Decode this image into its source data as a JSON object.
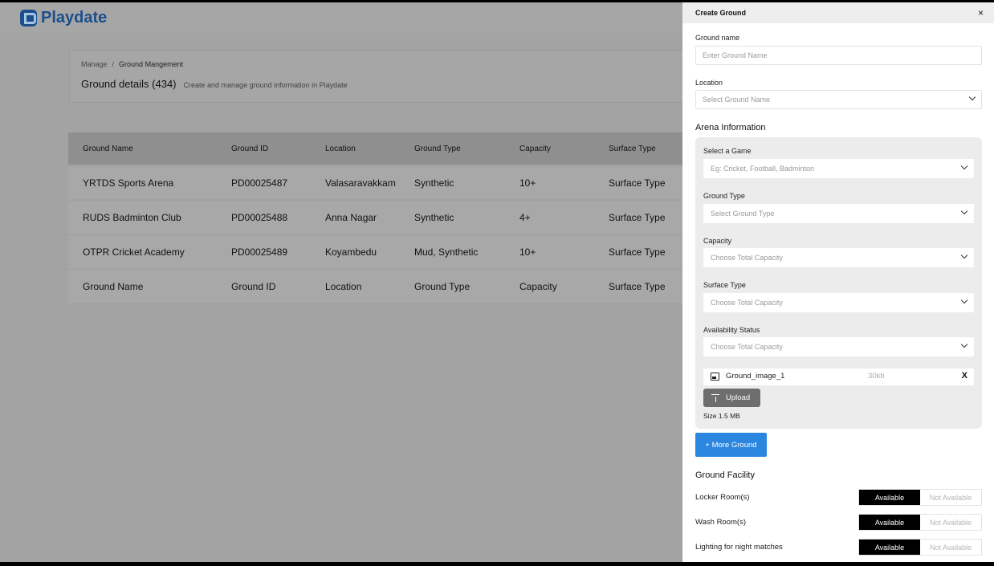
{
  "app": {
    "name": "Playdate"
  },
  "breadcrumb": {
    "root": "Manage",
    "separator": "/",
    "current": "Ground Mangement"
  },
  "page": {
    "title": "Ground details (434)",
    "subtitle": "Create and manage ground information in Playdate"
  },
  "table": {
    "columns": [
      "Ground Name",
      "Ground ID",
      "Location",
      "Ground Type",
      "Capacity",
      "Surface Type"
    ],
    "rows": [
      [
        "YRTDS Sports Arena",
        "PD00025487",
        "Valasaravakkam",
        "Synthetic",
        "10+",
        "Surface Type"
      ],
      [
        "RUDS Badminton Club",
        "PD00025488",
        "Anna Nagar",
        "Synthetic",
        "4+",
        "Surface Type"
      ],
      [
        "OTPR Cricket Academy",
        "PD00025489",
        "Koyambedu",
        "Mud, Synthetic",
        "10+",
        "Surface Type"
      ],
      [
        "Ground Name",
        "Ground ID",
        "Location",
        "Ground Type",
        "Capacity",
        "Surface Type"
      ]
    ]
  },
  "panel": {
    "title": "Create Ground",
    "close": "×",
    "ground_name": {
      "label": "Ground name",
      "placeholder": "Enter Ground Name"
    },
    "location": {
      "label": "Location",
      "placeholder": "Select Ground Name"
    },
    "arena_title": "Arena Information",
    "arena_fields": [
      {
        "label": "Select a Game",
        "placeholder": "Eg: Cricket, Football, Badminton"
      },
      {
        "label": "Ground Type",
        "placeholder": "Select Ground Type"
      },
      {
        "label": "Capacity",
        "placeholder": "Choose Total Capacity"
      },
      {
        "label": "Surface Type",
        "placeholder": "Choose Total Capacity"
      },
      {
        "label": "Availability Status",
        "placeholder": "Choose Total Capacity"
      }
    ],
    "file": {
      "name": "Ground_image_1",
      "size": "30kb",
      "remove": "X"
    },
    "upload_label": "Upload",
    "size_note": "Size 1.5 MB",
    "more_ground": "+ More Ground",
    "facility_title": "Ground Facility",
    "facilities": [
      {
        "label": "Locker Room(s)",
        "on": "Available",
        "off": "Not Available"
      },
      {
        "label": "Wash Room(s)",
        "on": "Available",
        "off": "Not Available"
      },
      {
        "label": "Lighting for night matches",
        "on": "Available",
        "off": "Not Available"
      }
    ]
  }
}
